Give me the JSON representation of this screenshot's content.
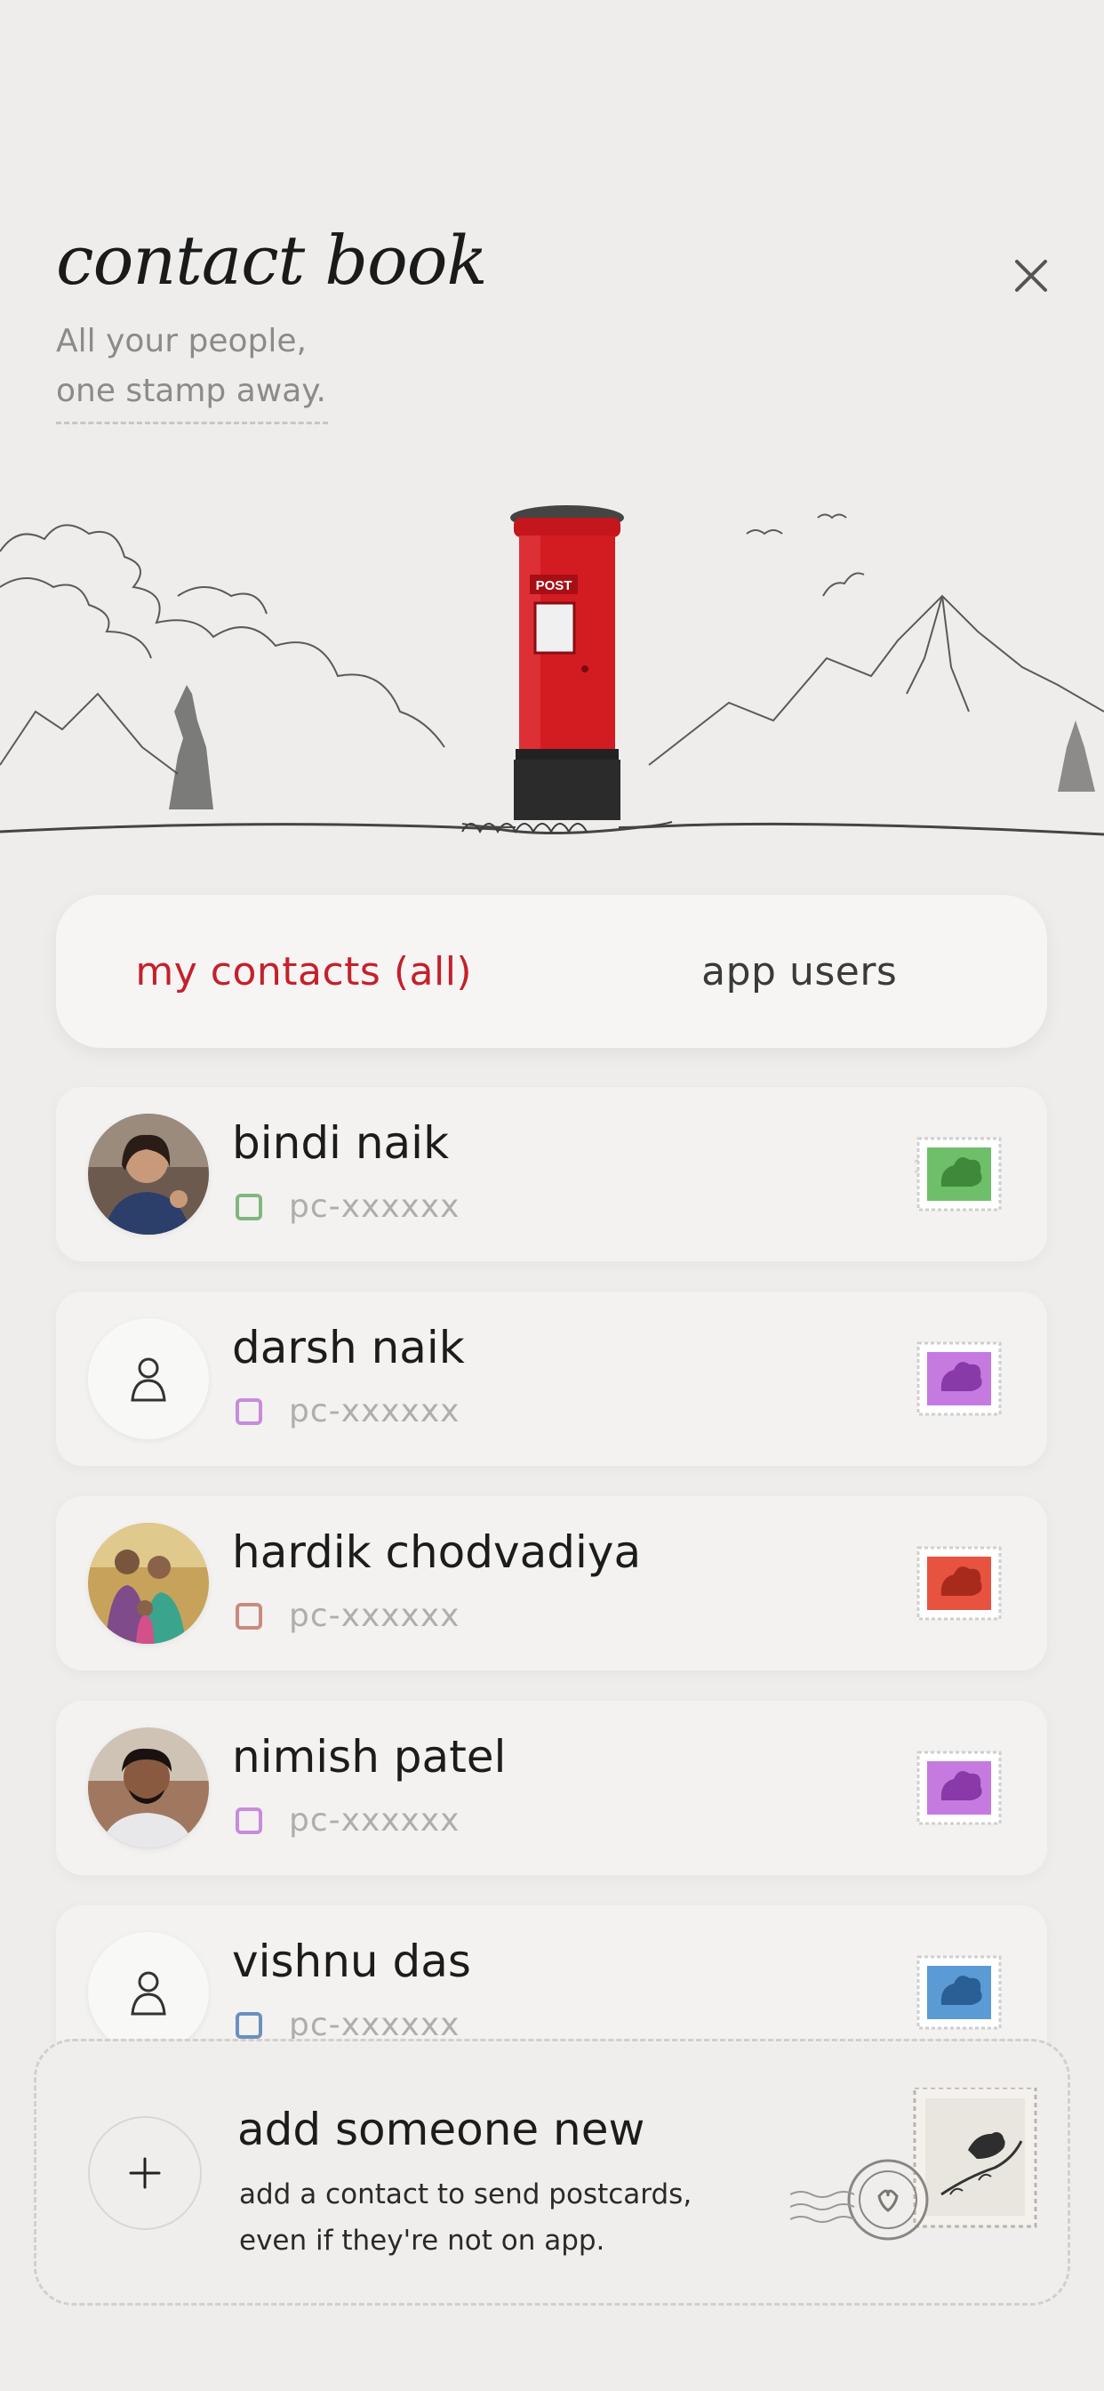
{
  "header": {
    "title": "contact book",
    "subtitle_line1": "All your people,",
    "subtitle_line2": "one stamp away.",
    "postbox_sign": "POST"
  },
  "tabs": [
    {
      "label": "my contacts (all)",
      "active": true
    },
    {
      "label": "app users",
      "active": false
    }
  ],
  "contacts": [
    {
      "name": "bindi naik",
      "code": "pc-xxxxxx",
      "has_photo": true,
      "stamp_color": "#6fbf6a"
    },
    {
      "name": "darsh naik",
      "code": "pc-xxxxxx",
      "has_photo": false,
      "stamp_color": "#c57ae0"
    },
    {
      "name": "hardik chodvadiya",
      "code": "pc-xxxxxx",
      "has_photo": true,
      "stamp_color": "#e8533f"
    },
    {
      "name": "nimish patel",
      "code": "pc-xxxxxx",
      "has_photo": true,
      "stamp_color": "#c57ae0"
    },
    {
      "name": "vishnu das",
      "code": "pc-xxxxxx",
      "has_photo": false,
      "stamp_color": "#5b9bd5"
    }
  ],
  "add_contact": {
    "title": "add someone new",
    "desc_line1": "add a contact to send postcards,",
    "desc_line2": "even if they're not on app."
  },
  "colors": {
    "accent": "#c5202b",
    "background": "#efedeb",
    "card": "#f3f2f0"
  }
}
